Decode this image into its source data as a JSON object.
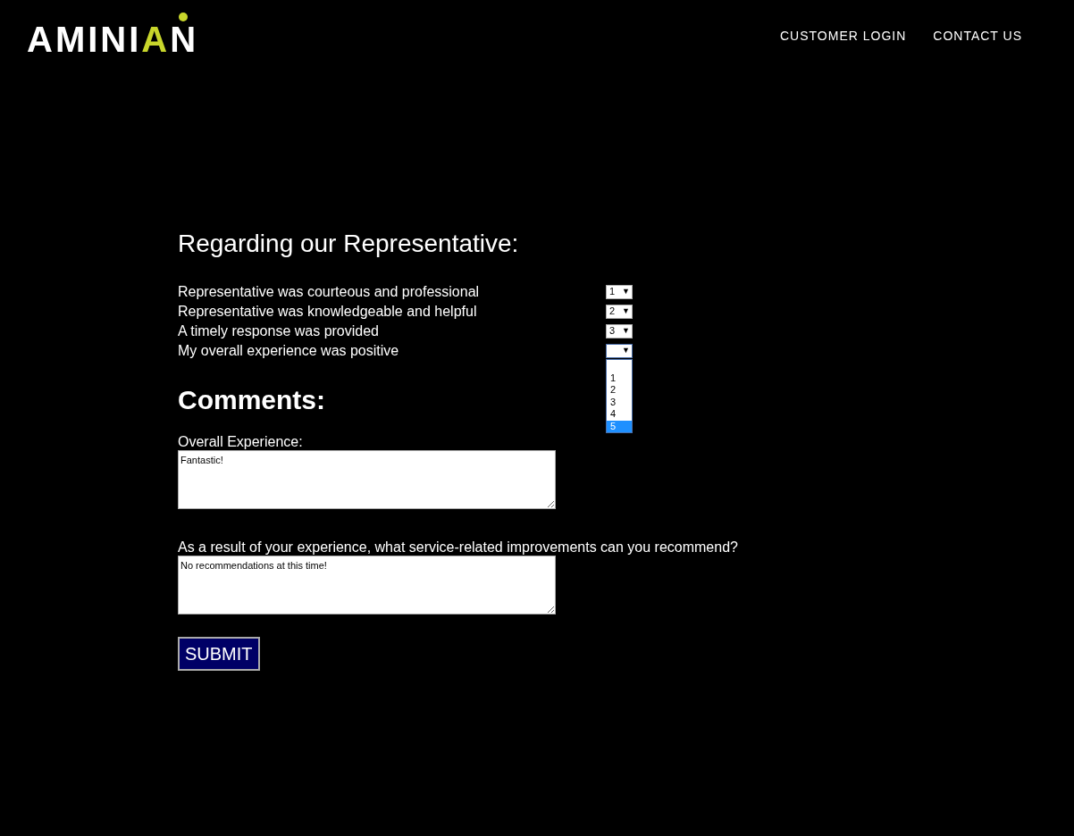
{
  "logo": {
    "lead": "AMINI",
    "accent": "A",
    "tail": "N"
  },
  "nav": [
    {
      "label": "CUSTOMER LOGIN"
    },
    {
      "label": "CONTACT US"
    }
  ],
  "section_title": "Regarding our Representative:",
  "ratings": [
    {
      "label": "Representative was courteous and professional",
      "value": "1",
      "expanded": false
    },
    {
      "label": "Representative was knowledgeable and helpful",
      "value": "2",
      "expanded": false
    },
    {
      "label": "A timely response was provided",
      "value": "3",
      "expanded": false
    },
    {
      "label": "My overall experience was positive",
      "expanded": true,
      "options": [
        {
          "label": "1",
          "selected": false
        },
        {
          "label": "2",
          "selected": false
        },
        {
          "label": "3",
          "selected": false
        },
        {
          "label": "4",
          "selected": false
        },
        {
          "label": "5",
          "selected": true
        }
      ]
    }
  ],
  "arrow": "▼",
  "comments_title": "Comments:",
  "fields": [
    {
      "label": "Overall Experience:",
      "value": "Fantastic!"
    },
    {
      "label": "As a result of your experience, what service-related improvements can you recommend?",
      "value": "No recommendations at this time!"
    }
  ],
  "submit": "SUBMIT"
}
